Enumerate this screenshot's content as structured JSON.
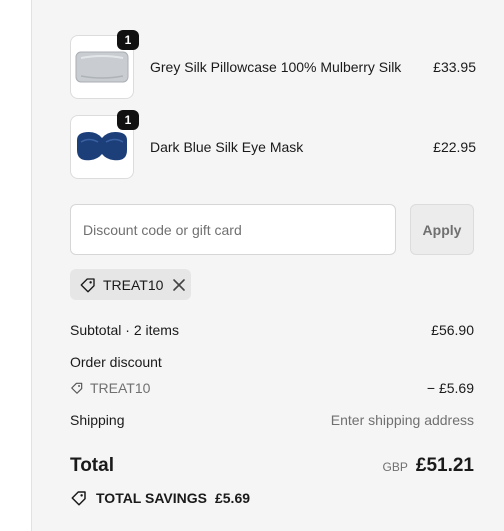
{
  "items": [
    {
      "name": "Grey Silk Pillowcase 100% Mulberry Silk",
      "price": "£33.95",
      "quantity": "1",
      "image": "grey-pillowcase",
      "image_color": "#c9cdd1"
    },
    {
      "name": "Dark Blue Silk Eye Mask",
      "price": "£22.95",
      "quantity": "1",
      "image": "blue-eye-mask",
      "image_color": "#1c3f7a"
    }
  ],
  "discount": {
    "placeholder": "Discount code or gift card",
    "value": "",
    "apply_label": "Apply",
    "applied_code": "TREAT10"
  },
  "summary": {
    "subtotal_label": "Subtotal · 2 items",
    "subtotal_value": "£56.90",
    "order_discount_label": "Order discount",
    "discount_code": "TREAT10",
    "discount_value": "− £5.69",
    "shipping_label": "Shipping",
    "shipping_value": "Enter shipping address",
    "total_label": "Total",
    "currency": "GBP",
    "total_value": "£51.21",
    "savings_label": "TOTAL SAVINGS",
    "savings_value": "£5.69"
  },
  "colors": {
    "background": "#f5f5f5",
    "text": "#1a1a1a",
    "muted": "#707070",
    "badge": "#111111"
  }
}
